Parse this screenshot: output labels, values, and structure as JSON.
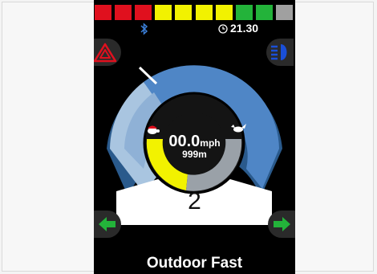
{
  "battery": {
    "segments": [
      "#e0101e",
      "#e0101e",
      "#e0101e",
      "#f2f200",
      "#f2f200",
      "#f2f200",
      "#f2f200",
      "#23b33a",
      "#23b33a",
      "#a0a0a0"
    ]
  },
  "status": {
    "bluetooth_icon": "bluetooth-icon",
    "clock_icon": "clock-icon",
    "time": "21.30"
  },
  "buttons": {
    "hazard_icon": "hazard-warning-icon",
    "lights_icon": "headlight-icon",
    "left_icon": "arrow-left-icon",
    "right_icon": "arrow-right-icon"
  },
  "speed": {
    "value": "00.0",
    "unit": "mph",
    "distance": "999m",
    "speed_limit_fraction": 0.55,
    "slow_icon": "tortoise-icon",
    "fast_icon": "hare-icon"
  },
  "drive": {
    "gear": "2",
    "profile": "Outdoor Fast"
  },
  "colors": {
    "accent_blue": "#4f86c6",
    "light_blue": "#a9c5e0",
    "dark_blue": "#2a5a8c",
    "yellow": "#f2f200",
    "gray": "#9aa1a8"
  }
}
